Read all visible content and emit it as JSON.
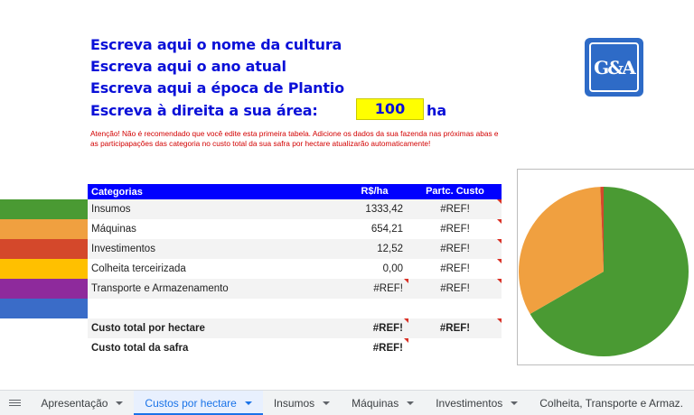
{
  "header": {
    "line1": "Escreva aqui o nome da cultura",
    "line2": "Escreva aqui o ano atual",
    "line3": "Escreva aqui a época de Plantio",
    "line4": "Escreva à direita a sua área:",
    "area_value": "100",
    "area_unit": "ha"
  },
  "warning": "Atenção! Não é recomendado que você edite esta primeira tabela. Adicione os dados da sua fazenda nas próximas abas e as participapações das categoria no custo total da sua safra por hectare atualizarão automaticamente!",
  "logo": {
    "text": "G&A"
  },
  "table": {
    "headers": {
      "category": "Categorias",
      "value": "R$/ha",
      "share": "Partc. Custo"
    },
    "rows": [
      {
        "category": "Insumos",
        "value": "1333,42",
        "share": "#REF!",
        "color": "#4a9a33"
      },
      {
        "category": "Máquinas",
        "value": "654,21",
        "share": "#REF!",
        "color": "#f0a040"
      },
      {
        "category": "Investimentos",
        "value": "12,52",
        "share": "#REF!",
        "color": "#d4482b"
      },
      {
        "category": "Colheita terceirizada",
        "value": "0,00",
        "share": "#REF!",
        "color": "#ffc000"
      },
      {
        "category": "Transporte e Armazenamento",
        "value": "#REF!",
        "share": "#REF!",
        "color": "#8e2a9c"
      },
      {
        "category": "",
        "value": "",
        "share": "",
        "color": "#3a6cc8"
      }
    ],
    "total_hectare": {
      "label": "Custo total por hectare",
      "value": "#REF!",
      "share": "#REF!"
    },
    "total_safra": {
      "label": "Custo total da safra",
      "value": "#REF!"
    }
  },
  "chart_data": {
    "type": "pie",
    "slices": [
      {
        "label": "Insumos",
        "value": 1333.42,
        "color": "#4a9a33"
      },
      {
        "label": "Máquinas",
        "value": 654.21,
        "color": "#f0a040"
      },
      {
        "label": "Investimentos",
        "value": 12.52,
        "color": "#d4482b"
      },
      {
        "label": "Colheita terceirizada",
        "value": 0.0,
        "color": "#ffc000"
      }
    ]
  },
  "tabs": [
    {
      "label": "Apresentação",
      "active": false
    },
    {
      "label": "Custos por hectare",
      "active": true
    },
    {
      "label": "Insumos",
      "active": false
    },
    {
      "label": "Máquinas",
      "active": false
    },
    {
      "label": "Investimentos",
      "active": false
    },
    {
      "label": "Colheita, Transporte e Armaz.",
      "active": false
    }
  ]
}
